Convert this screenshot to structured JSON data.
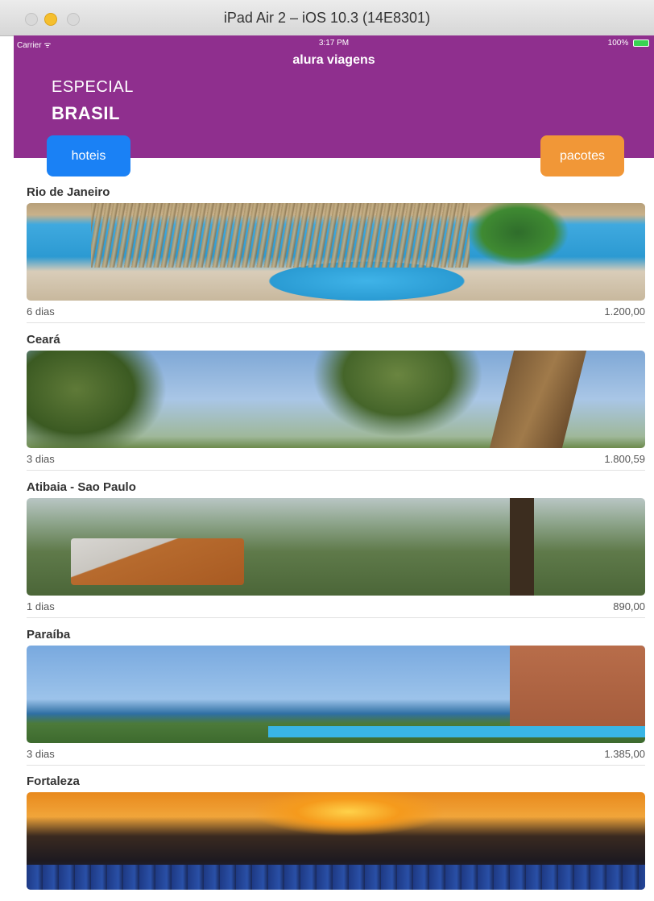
{
  "window": {
    "title": "iPad Air 2 – iOS 10.3 (14E8301)"
  },
  "status_bar": {
    "carrier": "Carrier",
    "time": "3:17 PM",
    "battery": "100%"
  },
  "app": {
    "title": "alura viagens"
  },
  "header": {
    "label": "ESPECIAL",
    "country": "BRASIL"
  },
  "buttons": {
    "left": "hoteis",
    "right": "pacotes"
  },
  "colors": {
    "header_bg": "#8f2f8e",
    "hoteis_bg": "#1a81f5",
    "pacotes_bg": "#f19737"
  },
  "packages": [
    {
      "name": "Rio de Janeiro",
      "days": "6 dias",
      "price": "1.200,00"
    },
    {
      "name": "Ceará",
      "days": "3 dias",
      "price": "1.800,59"
    },
    {
      "name": "Atibaia - Sao Paulo",
      "days": "1 dias",
      "price": "890,00"
    },
    {
      "name": "Paraíba",
      "days": "3 dias",
      "price": "1.385,00"
    },
    {
      "name": "Fortaleza",
      "days": "",
      "price": ""
    }
  ]
}
